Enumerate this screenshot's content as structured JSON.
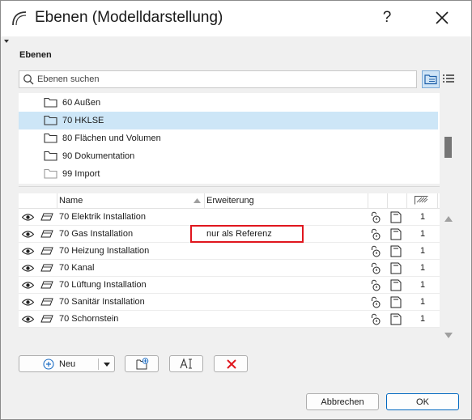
{
  "window": {
    "title": "Ebenen (Modelldarstellung)",
    "help_label": "?"
  },
  "section": {
    "label": "Ebenen"
  },
  "search": {
    "placeholder": "Ebenen suchen"
  },
  "tree": {
    "items": [
      {
        "label": "60 Außen",
        "selected": false,
        "folder_style": "filled"
      },
      {
        "label": "70 HKLSE",
        "selected": true,
        "folder_style": "filled"
      },
      {
        "label": "80 Flächen und Volumen",
        "selected": false,
        "folder_style": "filled"
      },
      {
        "label": "90 Dokumentation",
        "selected": false,
        "folder_style": "filled"
      },
      {
        "label": "99 Import",
        "selected": false,
        "folder_style": "outline"
      }
    ]
  },
  "table": {
    "columns": {
      "name": "Name",
      "extension": "Erweiterung"
    },
    "rows": [
      {
        "name": "70 Elektrik Installation",
        "extension": "",
        "number": "1"
      },
      {
        "name": "70 Gas Installation",
        "extension": "nur als Referenz",
        "number": "1"
      },
      {
        "name": "70 Heizung Installation",
        "extension": "",
        "number": "1"
      },
      {
        "name": "70 Kanal",
        "extension": "",
        "number": "1"
      },
      {
        "name": "70 Lüftung Installation",
        "extension": "",
        "number": "1"
      },
      {
        "name": "70 Sanitär Installation",
        "extension": "",
        "number": "1"
      },
      {
        "name": "70 Schornstein",
        "extension": "",
        "number": "1"
      }
    ]
  },
  "toolbar": {
    "new_label": "Neu"
  },
  "footer": {
    "cancel_label": "Abbrechen",
    "ok_label": "OK"
  },
  "colors": {
    "selection": "#cde6f7",
    "highlight_border": "#e0161e",
    "delete_icon": "#e0161e",
    "add_icon": "#1f6fc5",
    "ok_border": "#0067c0"
  }
}
